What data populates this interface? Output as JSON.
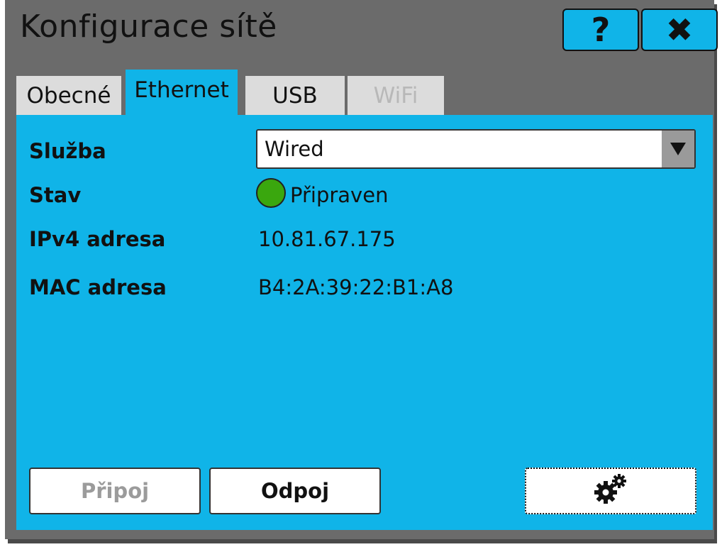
{
  "window": {
    "title": "Konfigurace sítě",
    "help_label": "?",
    "close_label": "✖"
  },
  "tabs": [
    {
      "label": "Obecné",
      "state": "inactive"
    },
    {
      "label": "Ethernet",
      "state": "active"
    },
    {
      "label": "USB",
      "state": "inactive"
    },
    {
      "label": "WiFi",
      "state": "disabled"
    }
  ],
  "form": {
    "service_label": "Služba",
    "service_value": "Wired",
    "status_label": "Stav",
    "status_value": "Připraven",
    "status_color": "#3aa70e",
    "ipv4_label": "IPv4 adresa",
    "ipv4_value": "10.81.67.175",
    "mac_label": "MAC adresa",
    "mac_value": "B4:2A:39:22:B1:A8"
  },
  "actions": {
    "connect_label": "Připoj",
    "disconnect_label": "Odpoj",
    "settings_icon": "gears-icon"
  },
  "colors": {
    "accent": "#10b4e8",
    "window_bg": "#6b6b6b",
    "tab_inactive": "#dcdcdc"
  }
}
